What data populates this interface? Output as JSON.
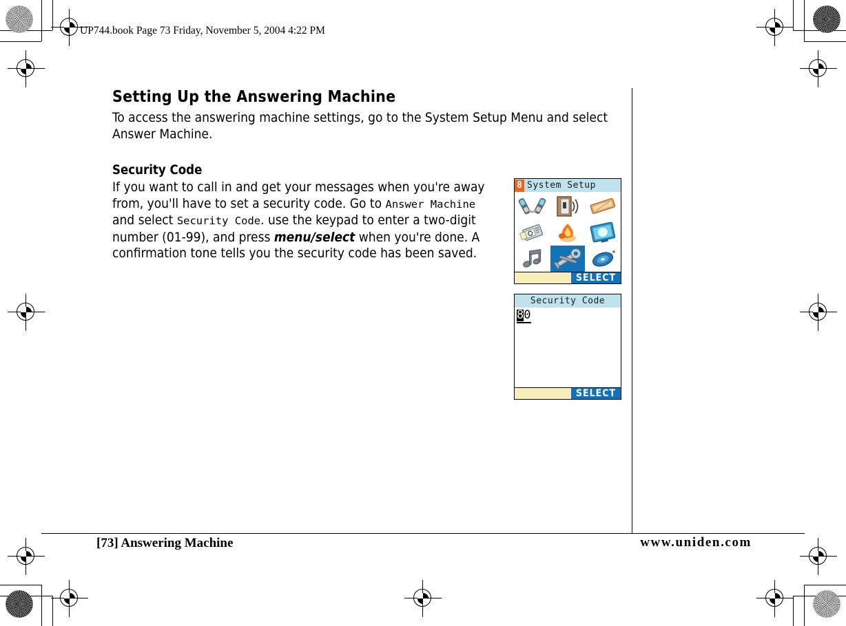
{
  "book_header": "UP744.book  Page 73  Friday, November 5, 2004  4:22 PM",
  "content": {
    "section_title": "Setting Up the Answering Machine",
    "intro_paragraph": "To access the answering machine settings, go to the System Setup Menu and select Answer Machine.",
    "sub_title": "Security Code",
    "security_text_1": "If you want to call in and get your messages when you're away from, you'll have to set a security code. Go to ",
    "security_term_1": "Answer Machine",
    "security_text_2": " and select ",
    "security_term_2": "Security Code",
    "security_text_3": ". use the keypad to enter a two-digit number (01-99), and press ",
    "security_emphasis": "menu/select",
    "security_text_4": " when you're done. A confirmation tone tells you the security code has been saved."
  },
  "lcd_menu": {
    "badge": "8",
    "title": "System Setup",
    "icons": [
      "two-handsets-intercom-icon",
      "door-ringer-icon",
      "wooden-tray-icon",
      "address-book-icon",
      "flame-alert-icon",
      "display-monitor-icon",
      "music-notes-icon",
      "wrench-tools-icon",
      "blue-disc-icon"
    ],
    "selected_index": 7,
    "softkey_select": "SELECT"
  },
  "lcd_code": {
    "title": "Security Code",
    "value_cursor_digit": "8",
    "value_second_digit": "0",
    "softkey_select": "SELECT"
  },
  "footer": {
    "left": "[73] Answering Machine",
    "right": "www.uniden.com"
  },
  "colors": {
    "lcd_titlebar": "#bfe2ef",
    "lcd_badge": "#f2631b",
    "lcd_accent_blue": "#1272b8",
    "lcd_softkey_bg": "#f7eebc"
  }
}
